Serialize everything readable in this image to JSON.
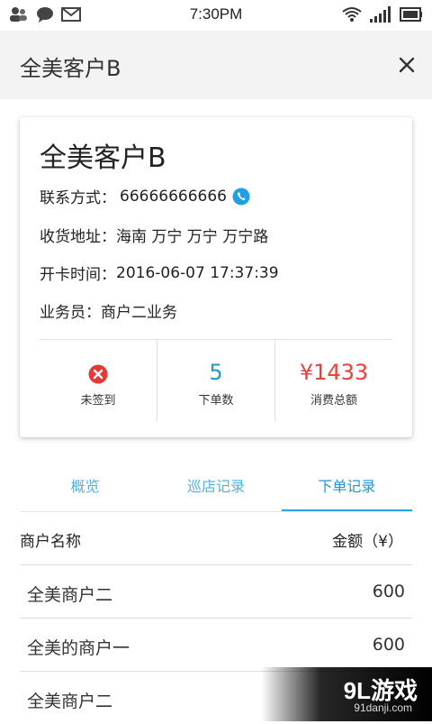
{
  "status_bar": {
    "time": "7:30PM",
    "icons_left": [
      "contacts-icon",
      "chat-bubble-icon",
      "mail-icon"
    ],
    "icons_right": [
      "wifi-icon",
      "signal-icon",
      "battery-icon"
    ]
  },
  "header": {
    "title": "全美客户B"
  },
  "customer_card": {
    "name": "全美客户B",
    "contact_label": "联系方式：",
    "contact_value": "66666666666",
    "address_label": "收货地址：",
    "address_value": "海南 万宁 万宁 万宁路",
    "opened_label": "开卡时间：",
    "opened_value": "2016-06-07 17:37:39",
    "salesman_label": "业务员：",
    "salesman_value": "商户二业务",
    "stats": {
      "checkin_caption": "未签到",
      "orders_value": "5",
      "orders_caption": "下单数",
      "spend_value": "¥1433",
      "spend_caption": "消费总额"
    }
  },
  "tabs": [
    {
      "label": "概览",
      "active": false
    },
    {
      "label": "巡店记录",
      "active": false
    },
    {
      "label": "下单记录",
      "active": true
    }
  ],
  "table": {
    "headers": {
      "merchant": "商户名称",
      "amount": "金额（¥）"
    },
    "rows": [
      {
        "merchant": "全美商户二",
        "amount": "600"
      },
      {
        "merchant": "全美的商户一",
        "amount": "600"
      },
      {
        "merchant": "全美商户二",
        "amount": ""
      }
    ]
  },
  "watermark": {
    "brand": "9L游戏",
    "url": "91danji.com"
  },
  "colors": {
    "accent_blue": "#2196d3",
    "spend_red": "#e8413c",
    "checkin_red": "#e53935",
    "header_bg": "#f3f3f3"
  }
}
